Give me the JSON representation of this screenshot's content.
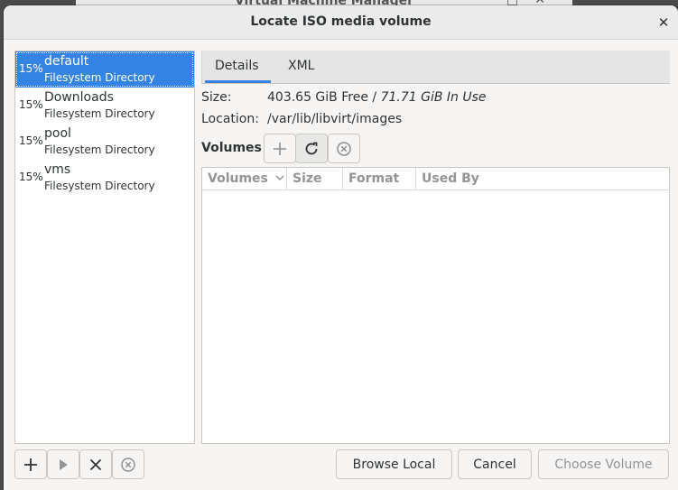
{
  "background_window": {
    "title": "Virtual Machine Manager"
  },
  "dialog": {
    "title": "Locate ISO media volume",
    "close_icon": "close-icon"
  },
  "pools": [
    {
      "percent": "15%",
      "name": "default",
      "type": "Filesystem Directory",
      "selected": true
    },
    {
      "percent": "15%",
      "name": "Downloads",
      "type": "Filesystem Directory",
      "selected": false
    },
    {
      "percent": "15%",
      "name": "pool",
      "type": "Filesystem Directory",
      "selected": false
    },
    {
      "percent": "15%",
      "name": "vms",
      "type": "Filesystem Directory",
      "selected": false
    }
  ],
  "tabs": {
    "details": "Details",
    "xml": "XML",
    "active": "Details"
  },
  "details": {
    "size_label": "Size:",
    "size_free": "403.65 GiB Free",
    "size_sep": " / ",
    "size_in_use": "71.71 GiB In Use",
    "location_label": "Location:",
    "location_value": "/var/lib/libvirt/images",
    "volumes_label": "Volumes"
  },
  "volume_table": {
    "columns": [
      "Volumes",
      "Size",
      "Format",
      "Used By"
    ],
    "rows": []
  },
  "buttons": {
    "browse_local": "Browse Local",
    "cancel": "Cancel",
    "choose_volume": "Choose Volume"
  },
  "colors": {
    "accent": "#3584e4",
    "disabled_text": "#949494"
  }
}
